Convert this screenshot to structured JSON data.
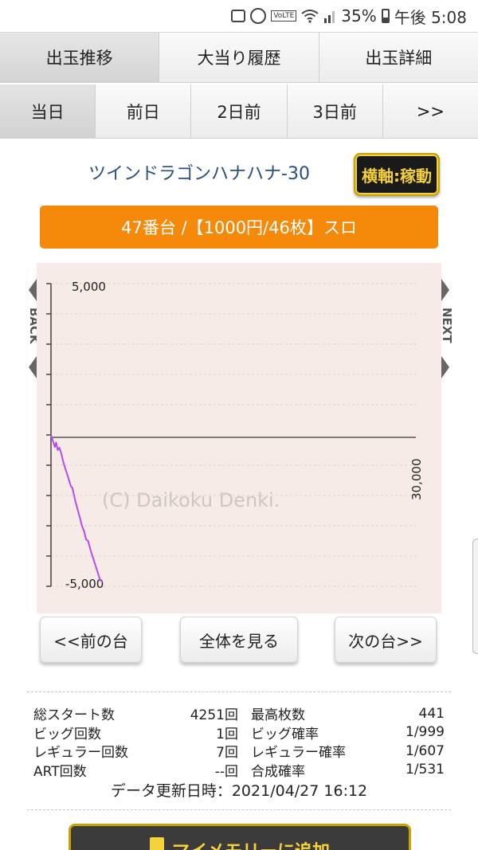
{
  "status_bar": {
    "battery": "35%",
    "time": "午後 5:08"
  },
  "tabs_main": [
    {
      "label": "出玉推移",
      "active": true
    },
    {
      "label": "大当り履歴",
      "active": false
    },
    {
      "label": "出玉詳細",
      "active": false
    }
  ],
  "tabs_day": [
    {
      "label": "当日",
      "active": true
    },
    {
      "label": "前日",
      "active": false
    },
    {
      "label": "2日前",
      "active": false
    },
    {
      "label": "3日前",
      "active": false
    },
    {
      "label": ">>",
      "active": false
    }
  ],
  "machine_name": "ツインドラゴンハナハナ-30",
  "axis_toggle_label": "横軸:稼動",
  "unit_info": "47番台 /【1000円/46枚】スロ",
  "nav": {
    "back": "BACK",
    "next": "NEXT"
  },
  "chart_data": {
    "type": "line",
    "series": [
      {
        "color": "#b34dee",
        "points": [
          [
            0,
            0
          ],
          [
            200,
            -250
          ],
          [
            320,
            -400
          ],
          [
            420,
            -250
          ],
          [
            560,
            -500
          ],
          [
            700,
            -420
          ],
          [
            840,
            -600
          ],
          [
            1050,
            -950
          ],
          [
            1250,
            -1200
          ],
          [
            1450,
            -1450
          ],
          [
            1640,
            -1700
          ],
          [
            1760,
            -1750
          ],
          [
            1950,
            -2100
          ],
          [
            2150,
            -2400
          ],
          [
            2350,
            -2700
          ],
          [
            2550,
            -3000
          ],
          [
            2740,
            -3200
          ],
          [
            2880,
            -3450
          ],
          [
            3050,
            -3500
          ],
          [
            3250,
            -3800
          ],
          [
            3450,
            -4050
          ],
          [
            3650,
            -4300
          ],
          [
            3850,
            -4550
          ],
          [
            4050,
            -4800
          ],
          [
            4251,
            -4850
          ]
        ]
      }
    ],
    "ylim": [
      -5000,
      5000
    ],
    "xlim": [
      0,
      30000
    ],
    "y_tick_labels": [
      "5,000",
      "-5,000"
    ],
    "x_tick_labels": [
      "30,000"
    ],
    "watermark": "(C) Daikoku Denki.",
    "grid": true,
    "background": "#f6ebe6"
  },
  "buttons": {
    "prev": "<<前の台",
    "all": "全体を見る",
    "next": "次の台>>"
  },
  "stats": [
    {
      "label": "総スタート数",
      "value": "4251回",
      "label2": "最高枚数",
      "value2": "441"
    },
    {
      "label": "ビッグ回数",
      "value": "1回",
      "label2": "ビッグ確率",
      "value2": "1/999"
    },
    {
      "label": "レギュラー回数",
      "value": "7回",
      "label2": "レギュラー確率",
      "value2": "1/607"
    },
    {
      "label": "ART回数",
      "value": "--回",
      "label2": "合成確率",
      "value2": "1/531"
    }
  ],
  "updated_label": "データ更新日時：2021/04/27 16:12",
  "memory_button": "マイメモリーに追加",
  "colors": {
    "orange": "#f58a0a",
    "gold": "#c9a400",
    "line": "#b34dee",
    "title_blue": "#2a4f7a"
  }
}
